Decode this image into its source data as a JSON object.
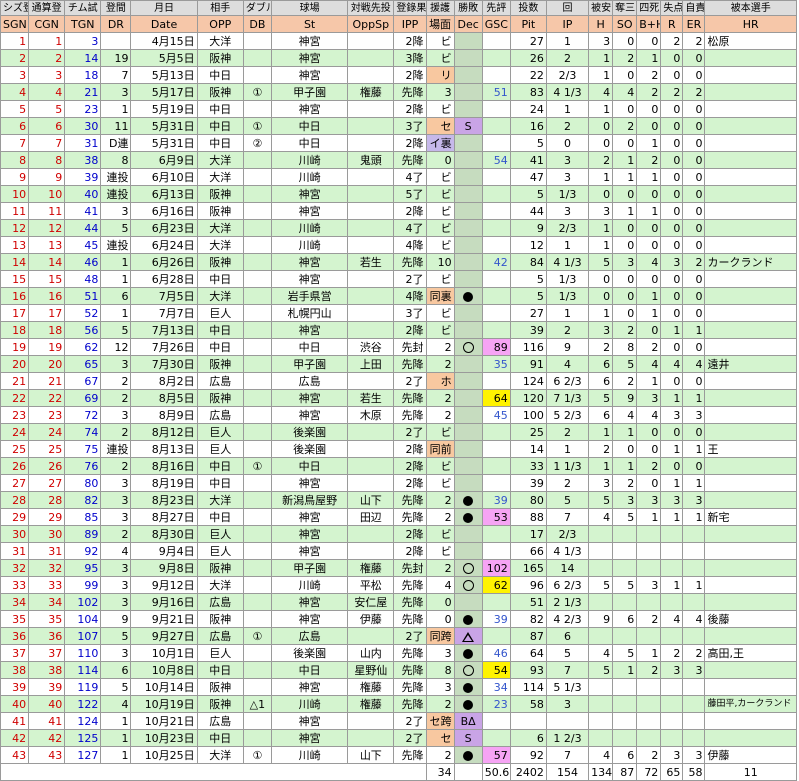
{
  "header_jp": [
    "シズ登",
    "通算登",
    "チム試",
    "登間",
    "月日",
    "相手",
    "ダブル",
    "球場",
    "対戦先投",
    "登錄果",
    "援護",
    "勝敗",
    "先評",
    "投数",
    "回",
    "被安",
    "奪三",
    "四死",
    "失点",
    "自責",
    "被本選手"
  ],
  "header_en": [
    "SGN",
    "CGN",
    "TGN",
    "DR",
    "Date",
    "OPP",
    "DB",
    "St",
    "OppSp",
    "IPP",
    "場面",
    "Dec",
    "GSC",
    "Pit",
    "IP",
    "H",
    "SO",
    "B+H",
    "R",
    "ER",
    "HR"
  ],
  "rows": [
    {
      "sgn": "1",
      "cgn": "1",
      "tgn": "3",
      "dr": "",
      "date": "4月15日",
      "opp": "大洋",
      "db": "",
      "st": "神宮",
      "oppsp": "",
      "ipp": "2降",
      "scene": "ビ",
      "dec": "",
      "gsc": "",
      "pit": "27",
      "ip": "1",
      "h": "3",
      "so": "0",
      "bh": "0",
      "r": "2",
      "er": "2",
      "hr": "松原"
    },
    {
      "sgn": "2",
      "cgn": "2",
      "tgn": "14",
      "dr": "19",
      "date": "5月5日",
      "opp": "阪神",
      "db": "",
      "st": "神宮",
      "oppsp": "",
      "ipp": "3降",
      "scene": "ビ",
      "dec": "",
      "gsc": "",
      "pit": "26",
      "ip": "2",
      "h": "1",
      "so": "2",
      "bh": "1",
      "r": "0",
      "er": "0",
      "hr": ""
    },
    {
      "sgn": "3",
      "cgn": "3",
      "tgn": "18",
      "dr": "7",
      "date": "5月13日",
      "opp": "中日",
      "db": "",
      "st": "神宮",
      "oppsp": "",
      "ipp": "2降",
      "scene": "リ",
      "dec": "",
      "gsc": "",
      "pit": "22",
      "ip": "2/3",
      "h": "1",
      "so": "0",
      "bh": "2",
      "r": "0",
      "er": "0",
      "hr": ""
    },
    {
      "sgn": "4",
      "cgn": "4",
      "tgn": "21",
      "dr": "3",
      "date": "5月17日",
      "opp": "阪神",
      "db": "①",
      "st": "甲子園",
      "oppsp": "権藤",
      "ipp": "先降",
      "scene": "3",
      "dec": "",
      "gsc": "51",
      "pit": "83",
      "ip": "4 1/3",
      "h": "4",
      "so": "4",
      "bh": "2",
      "r": "2",
      "er": "2",
      "hr": ""
    },
    {
      "sgn": "5",
      "cgn": "5",
      "tgn": "23",
      "dr": "1",
      "date": "5月19日",
      "opp": "中日",
      "db": "",
      "st": "神宮",
      "oppsp": "",
      "ipp": "2降",
      "scene": "ビ",
      "dec": "",
      "gsc": "",
      "pit": "24",
      "ip": "1",
      "h": "1",
      "so": "0",
      "bh": "0",
      "r": "0",
      "er": "0",
      "hr": ""
    },
    {
      "sgn": "6",
      "cgn": "6",
      "tgn": "30",
      "dr": "11",
      "date": "5月31日",
      "opp": "中日",
      "db": "①",
      "st": "中日",
      "oppsp": "",
      "ipp": "3了",
      "scene": "セ",
      "dec": "S",
      "gsc": "",
      "pit": "16",
      "ip": "2",
      "h": "0",
      "so": "2",
      "bh": "0",
      "r": "0",
      "er": "0",
      "hr": ""
    },
    {
      "sgn": "7",
      "cgn": "7",
      "tgn": "31",
      "dr": "D連",
      "date": "5月31日",
      "opp": "中日",
      "db": "②",
      "st": "中日",
      "oppsp": "",
      "ipp": "2降",
      "scene": "イ裏",
      "dec": "",
      "gsc": "",
      "pit": "5",
      "ip": "0",
      "h": "0",
      "so": "0",
      "bh": "1",
      "r": "0",
      "er": "0",
      "hr": ""
    },
    {
      "sgn": "8",
      "cgn": "8",
      "tgn": "38",
      "dr": "8",
      "date": "6月9日",
      "opp": "大洋",
      "db": "",
      "st": "川崎",
      "oppsp": "鬼頭",
      "ipp": "先降",
      "scene": "0",
      "dec": "",
      "gsc": "54",
      "pit": "41",
      "ip": "3",
      "h": "2",
      "so": "1",
      "bh": "2",
      "r": "0",
      "er": "0",
      "hr": ""
    },
    {
      "sgn": "9",
      "cgn": "9",
      "tgn": "39",
      "dr": "連投",
      "date": "6月10日",
      "opp": "大洋",
      "db": "",
      "st": "川崎",
      "oppsp": "",
      "ipp": "4了",
      "scene": "ビ",
      "dec": "",
      "gsc": "",
      "pit": "47",
      "ip": "3",
      "h": "1",
      "so": "1",
      "bh": "1",
      "r": "0",
      "er": "0",
      "hr": ""
    },
    {
      "sgn": "10",
      "cgn": "10",
      "tgn": "40",
      "dr": "連投",
      "date": "6月13日",
      "opp": "阪神",
      "db": "",
      "st": "神宮",
      "oppsp": "",
      "ipp": "5了",
      "scene": "ビ",
      "dec": "",
      "gsc": "",
      "pit": "5",
      "ip": "1/3",
      "h": "0",
      "so": "0",
      "bh": "0",
      "r": "0",
      "er": "0",
      "hr": ""
    },
    {
      "sgn": "11",
      "cgn": "11",
      "tgn": "41",
      "dr": "3",
      "date": "6月16日",
      "opp": "阪神",
      "db": "",
      "st": "神宮",
      "oppsp": "",
      "ipp": "2降",
      "scene": "ビ",
      "dec": "",
      "gsc": "",
      "pit": "44",
      "ip": "3",
      "h": "3",
      "so": "1",
      "bh": "1",
      "r": "0",
      "er": "0",
      "hr": ""
    },
    {
      "sgn": "12",
      "cgn": "12",
      "tgn": "44",
      "dr": "5",
      "date": "6月23日",
      "opp": "大洋",
      "db": "",
      "st": "川崎",
      "oppsp": "",
      "ipp": "4了",
      "scene": "ビ",
      "dec": "",
      "gsc": "",
      "pit": "9",
      "ip": "2/3",
      "h": "1",
      "so": "0",
      "bh": "0",
      "r": "0",
      "er": "0",
      "hr": ""
    },
    {
      "sgn": "13",
      "cgn": "13",
      "tgn": "45",
      "dr": "連投",
      "date": "6月24日",
      "opp": "大洋",
      "db": "",
      "st": "川崎",
      "oppsp": "",
      "ipp": "4降",
      "scene": "ビ",
      "dec": "",
      "gsc": "",
      "pit": "12",
      "ip": "1",
      "h": "1",
      "so": "0",
      "bh": "0",
      "r": "0",
      "er": "0",
      "hr": ""
    },
    {
      "sgn": "14",
      "cgn": "14",
      "tgn": "46",
      "dr": "1",
      "date": "6月26日",
      "opp": "阪神",
      "db": "",
      "st": "神宮",
      "oppsp": "若生",
      "ipp": "先降",
      "scene": "10",
      "dec": "",
      "gsc": "42",
      "pit": "84",
      "ip": "4 1/3",
      "h": "5",
      "so": "3",
      "bh": "4",
      "r": "3",
      "er": "2",
      "hr": "カークランド"
    },
    {
      "sgn": "15",
      "cgn": "15",
      "tgn": "48",
      "dr": "1",
      "date": "6月28日",
      "opp": "中日",
      "db": "",
      "st": "神宮",
      "oppsp": "",
      "ipp": "2了",
      "scene": "ビ",
      "dec": "",
      "gsc": "",
      "pit": "5",
      "ip": "1/3",
      "h": "0",
      "so": "0",
      "bh": "0",
      "r": "0",
      "er": "0",
      "hr": ""
    },
    {
      "sgn": "16",
      "cgn": "16",
      "tgn": "51",
      "dr": "6",
      "date": "7月5日",
      "opp": "大洋",
      "db": "",
      "st": "岩手県営",
      "oppsp": "",
      "ipp": "4降",
      "scene": "同裏",
      "dec": "win",
      "gsc": "",
      "pit": "5",
      "ip": "1/3",
      "h": "0",
      "so": "0",
      "bh": "1",
      "r": "0",
      "er": "0",
      "hr": ""
    },
    {
      "sgn": "17",
      "cgn": "17",
      "tgn": "52",
      "dr": "1",
      "date": "7月7日",
      "opp": "巨人",
      "db": "",
      "st": "札幌円山",
      "oppsp": "",
      "ipp": "3了",
      "scene": "ビ",
      "dec": "",
      "gsc": "",
      "pit": "27",
      "ip": "1",
      "h": "1",
      "so": "0",
      "bh": "1",
      "r": "0",
      "er": "0",
      "hr": ""
    },
    {
      "sgn": "18",
      "cgn": "18",
      "tgn": "56",
      "dr": "5",
      "date": "7月13日",
      "opp": "中日",
      "db": "",
      "st": "神宮",
      "oppsp": "",
      "ipp": "2降",
      "scene": "ビ",
      "dec": "",
      "gsc": "",
      "pit": "39",
      "ip": "2",
      "h": "3",
      "so": "2",
      "bh": "0",
      "r": "1",
      "er": "1",
      "hr": ""
    },
    {
      "sgn": "19",
      "cgn": "19",
      "tgn": "62",
      "dr": "12",
      "date": "7月26日",
      "opp": "中日",
      "db": "",
      "st": "中日",
      "oppsp": "渋谷",
      "ipp": "先封",
      "scene": "2",
      "dec": "circle",
      "gsc": "89",
      "pit": "116",
      "ip": "9",
      "h": "2",
      "so": "8",
      "bh": "2",
      "r": "0",
      "er": "0",
      "hr": ""
    },
    {
      "sgn": "20",
      "cgn": "20",
      "tgn": "65",
      "dr": "3",
      "date": "7月30日",
      "opp": "阪神",
      "db": "",
      "st": "甲子園",
      "oppsp": "上田",
      "ipp": "先降",
      "scene": "2",
      "dec": "",
      "gsc": "35",
      "pit": "91",
      "ip": "4",
      "h": "6",
      "so": "5",
      "bh": "4",
      "r": "4",
      "er": "4",
      "hr": "遠井"
    },
    {
      "sgn": "21",
      "cgn": "21",
      "tgn": "67",
      "dr": "2",
      "date": "8月2日",
      "opp": "広島",
      "db": "",
      "st": "広島",
      "oppsp": "",
      "ipp": "2了",
      "scene": "ホ",
      "dec": "",
      "gsc": "",
      "pit": "124",
      "ip": "6 2/3",
      "h": "6",
      "so": "2",
      "bh": "1",
      "r": "0",
      "er": "0",
      "hr": ""
    },
    {
      "sgn": "22",
      "cgn": "22",
      "tgn": "69",
      "dr": "2",
      "date": "8月5日",
      "opp": "阪神",
      "db": "",
      "st": "神宮",
      "oppsp": "若生",
      "ipp": "先降",
      "scene": "2",
      "dec": "",
      "gsc": "64",
      "pit": "120",
      "ip": "7 1/3",
      "h": "5",
      "so": "9",
      "bh": "3",
      "r": "1",
      "er": "1",
      "hr": ""
    },
    {
      "sgn": "23",
      "cgn": "23",
      "tgn": "72",
      "dr": "3",
      "date": "8月9日",
      "opp": "広島",
      "db": "",
      "st": "神宮",
      "oppsp": "木原",
      "ipp": "先降",
      "scene": "2",
      "dec": "",
      "gsc": "45",
      "pit": "100",
      "ip": "5 2/3",
      "h": "6",
      "so": "4",
      "bh": "4",
      "r": "3",
      "er": "3",
      "hr": ""
    },
    {
      "sgn": "24",
      "cgn": "24",
      "tgn": "74",
      "dr": "2",
      "date": "8月12日",
      "opp": "巨人",
      "db": "",
      "st": "後楽園",
      "oppsp": "",
      "ipp": "2了",
      "scene": "ビ",
      "dec": "",
      "gsc": "",
      "pit": "25",
      "ip": "2",
      "h": "1",
      "so": "1",
      "bh": "0",
      "r": "0",
      "er": "0",
      "hr": ""
    },
    {
      "sgn": "25",
      "cgn": "25",
      "tgn": "75",
      "dr": "連投",
      "date": "8月13日",
      "opp": "巨人",
      "db": "",
      "st": "後楽園",
      "oppsp": "",
      "ipp": "2降",
      "scene": "同前",
      "dec": "",
      "gsc": "",
      "pit": "14",
      "ip": "1",
      "h": "2",
      "so": "0",
      "bh": "0",
      "r": "1",
      "er": "1",
      "hr": "王"
    },
    {
      "sgn": "26",
      "cgn": "26",
      "tgn": "76",
      "dr": "2",
      "date": "8月16日",
      "opp": "中日",
      "db": "①",
      "st": "中日",
      "oppsp": "",
      "ipp": "2降",
      "scene": "ビ",
      "dec": "",
      "gsc": "",
      "pit": "33",
      "ip": "1 1/3",
      "h": "1",
      "so": "1",
      "bh": "2",
      "r": "0",
      "er": "0",
      "hr": ""
    },
    {
      "sgn": "27",
      "cgn": "27",
      "tgn": "80",
      "dr": "3",
      "date": "8月19日",
      "opp": "中日",
      "db": "",
      "st": "神宮",
      "oppsp": "",
      "ipp": "2降",
      "scene": "ビ",
      "dec": "",
      "gsc": "",
      "pit": "39",
      "ip": "2",
      "h": "3",
      "so": "2",
      "bh": "0",
      "r": "1",
      "er": "1",
      "hr": ""
    },
    {
      "sgn": "28",
      "cgn": "28",
      "tgn": "82",
      "dr": "3",
      "date": "8月23日",
      "opp": "大洋",
      "db": "",
      "st": "新潟鳥屋野",
      "oppsp": "山下",
      "ipp": "先降",
      "scene": "2",
      "dec": "win",
      "gsc": "39",
      "pit": "80",
      "ip": "5",
      "h": "5",
      "so": "3",
      "bh": "3",
      "r": "3",
      "er": "3",
      "hr": ""
    },
    {
      "sgn": "29",
      "cgn": "29",
      "tgn": "85",
      "dr": "3",
      "date": "8月27日",
      "opp": "中日",
      "db": "",
      "st": "神宮",
      "oppsp": "田辺",
      "ipp": "先降",
      "scene": "2",
      "dec": "win",
      "gsc": "53",
      "pit": "88",
      "ip": "7",
      "h": "4",
      "so": "5",
      "bh": "1",
      "r": "1",
      "er": "1",
      "hr": "新宅"
    },
    {
      "sgn": "30",
      "cgn": "30",
      "tgn": "89",
      "dr": "2",
      "date": "8月30日",
      "opp": "巨人",
      "db": "",
      "st": "神宮",
      "oppsp": "",
      "ipp": "2降",
      "scene": "ビ",
      "dec": "",
      "gsc": "",
      "pit": "17",
      "ip": "2/3",
      "h": "",
      "so": "",
      "bh": "",
      "r": "",
      "er": "",
      "hr": ""
    },
    {
      "sgn": "31",
      "cgn": "31",
      "tgn": "92",
      "dr": "4",
      "date": "9月4日",
      "opp": "巨人",
      "db": "",
      "st": "神宮",
      "oppsp": "",
      "ipp": "2降",
      "scene": "ビ",
      "dec": "",
      "gsc": "",
      "pit": "66",
      "ip": "4 1/3",
      "h": "",
      "so": "",
      "bh": "",
      "r": "",
      "er": "",
      "hr": ""
    },
    {
      "sgn": "32",
      "cgn": "32",
      "tgn": "95",
      "dr": "3",
      "date": "9月8日",
      "opp": "阪神",
      "db": "",
      "st": "甲子園",
      "oppsp": "権藤",
      "ipp": "先封",
      "scene": "2",
      "dec": "circle",
      "gsc": "102",
      "pit": "165",
      "ip": "14",
      "h": "",
      "so": "",
      "bh": "",
      "r": "",
      "er": "",
      "hr": ""
    },
    {
      "sgn": "33",
      "cgn": "33",
      "tgn": "99",
      "dr": "3",
      "date": "9月12日",
      "opp": "大洋",
      "db": "",
      "st": "川崎",
      "oppsp": "平松",
      "ipp": "先降",
      "scene": "4",
      "dec": "circle",
      "gsc": "62",
      "pit": "96",
      "ip": "6 2/3",
      "h": "5",
      "so": "5",
      "bh": "3",
      "r": "1",
      "er": "1",
      "hr": ""
    },
    {
      "sgn": "34",
      "cgn": "34",
      "tgn": "102",
      "dr": "3",
      "date": "9月16日",
      "opp": "広島",
      "db": "",
      "st": "神宮",
      "oppsp": "安仁屋",
      "ipp": "先降",
      "scene": "0",
      "dec": "",
      "gsc": "",
      "pit": "51",
      "ip": "2 1/3",
      "h": "",
      "so": "",
      "bh": "",
      "r": "",
      "er": "",
      "hr": ""
    },
    {
      "sgn": "35",
      "cgn": "35",
      "tgn": "104",
      "dr": "9",
      "date": "9月21日",
      "opp": "阪神",
      "db": "",
      "st": "神宮",
      "oppsp": "伊藤",
      "ipp": "先降",
      "scene": "0",
      "dec": "win",
      "gsc": "39",
      "pit": "82",
      "ip": "4 2/3",
      "h": "9",
      "so": "6",
      "bh": "2",
      "r": "4",
      "er": "4",
      "hr": "後藤"
    },
    {
      "sgn": "36",
      "cgn": "36",
      "tgn": "107",
      "dr": "5",
      "date": "9月27日",
      "opp": "広島",
      "db": "①",
      "st": "広島",
      "oppsp": "",
      "ipp": "2了",
      "scene": "同跨",
      "dec": "tri",
      "gsc": "",
      "pit": "87",
      "ip": "6",
      "h": "",
      "so": "",
      "bh": "",
      "r": "",
      "er": "",
      "hr": ""
    },
    {
      "sgn": "37",
      "cgn": "37",
      "tgn": "110",
      "dr": "3",
      "date": "10月1日",
      "opp": "巨人",
      "db": "",
      "st": "後楽園",
      "oppsp": "山内",
      "ipp": "先降",
      "scene": "3",
      "dec": "win",
      "gsc": "46",
      "pit": "64",
      "ip": "5",
      "h": "4",
      "so": "5",
      "bh": "1",
      "r": "2",
      "er": "2",
      "hr": "高田,王"
    },
    {
      "sgn": "38",
      "cgn": "38",
      "tgn": "114",
      "dr": "6",
      "date": "10月8日",
      "opp": "中日",
      "db": "",
      "st": "中日",
      "oppsp": "星野仙",
      "ipp": "先降",
      "scene": "8",
      "dec": "circle",
      "gsc": "54",
      "pit": "93",
      "ip": "7",
      "h": "5",
      "so": "1",
      "bh": "2",
      "r": "3",
      "er": "3",
      "hr": ""
    },
    {
      "sgn": "39",
      "cgn": "39",
      "tgn": "119",
      "dr": "5",
      "date": "10月14日",
      "opp": "阪神",
      "db": "",
      "st": "神宮",
      "oppsp": "権藤",
      "ipp": "先降",
      "scene": "3",
      "dec": "win",
      "gsc": "34",
      "pit": "114",
      "ip": "5 1/3",
      "h": "",
      "so": "",
      "bh": "",
      "r": "",
      "er": "",
      "hr": ""
    },
    {
      "sgn": "40",
      "cgn": "40",
      "tgn": "122",
      "dr": "4",
      "date": "10月19日",
      "opp": "阪神",
      "db": "△1",
      "st": "川崎",
      "oppsp": "権藤",
      "ipp": "先降",
      "scene": "2",
      "dec": "win",
      "gsc": "23",
      "pit": "58",
      "ip": "3",
      "h": "",
      "so": "",
      "bh": "",
      "r": "",
      "er": "",
      "hr": "藤田平,カークランド"
    },
    {
      "sgn": "41",
      "cgn": "41",
      "tgn": "124",
      "dr": "1",
      "date": "10月21日",
      "opp": "広島",
      "db": "",
      "st": "神宮",
      "oppsp": "",
      "ipp": "2了",
      "scene": "セ跨",
      "dec": "BΔ",
      "gsc": "",
      "pit": "",
      "ip": "",
      "h": "",
      "so": "",
      "bh": "",
      "r": "",
      "er": "",
      "hr": ""
    },
    {
      "sgn": "42",
      "cgn": "42",
      "tgn": "125",
      "dr": "1",
      "date": "10月23日",
      "opp": "中日",
      "db": "",
      "st": "神宮",
      "oppsp": "",
      "ipp": "2了",
      "scene": "セ",
      "dec": "S",
      "gsc": "",
      "pit": "6",
      "ip": "1 2/3",
      "h": "",
      "so": "",
      "bh": "",
      "r": "",
      "er": "",
      "hr": ""
    },
    {
      "sgn": "43",
      "cgn": "43",
      "tgn": "127",
      "dr": "1",
      "date": "10月25日",
      "opp": "大洋",
      "db": "①",
      "st": "川崎",
      "oppsp": "山下",
      "ipp": "先降",
      "scene": "2",
      "dec": "win",
      "gsc": "57",
      "pit": "92",
      "ip": "7",
      "h": "4",
      "so": "6",
      "bh": "2",
      "r": "3",
      "er": "3",
      "hr": "伊藤"
    }
  ],
  "totals": {
    "scene": "34",
    "gsc": "50.6",
    "pit": "2402",
    "ip": "154",
    "h": "134",
    "so": "87",
    "bh": "72",
    "r": "65",
    "er": "58",
    "hr": "11"
  },
  "colors": {
    "header_top": "#dddddd",
    "header_bottom": "#f6c7a9",
    "row_even": "#d4f4cf",
    "dec_bg": "#c6dcbf",
    "sgn_red": "#d00000",
    "tgn_blue": "#0000cc"
  }
}
